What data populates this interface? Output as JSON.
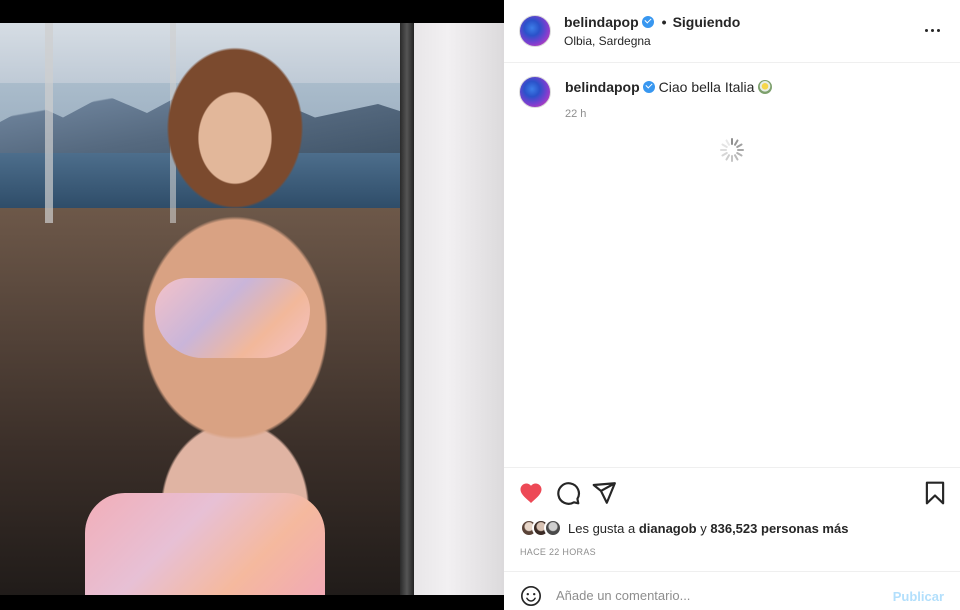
{
  "post": {
    "author": "belindapop",
    "dot": "•",
    "follow_status": "Siguiendo",
    "location": "Olbia, Sardegna",
    "caption_user": "belindapop",
    "caption_text": "Ciao bella Italia",
    "caption_emoji": "flower-emoji",
    "time_ago": "22 h"
  },
  "likes": {
    "prefix": "Les gusta a",
    "liked_by": "dianagob",
    "connector": "y",
    "count": "836,523",
    "suffix": "personas más"
  },
  "timestamp": "HACE 22 HORAS",
  "comment": {
    "placeholder": "Añade un comentario...",
    "publish_label": "Publicar"
  },
  "colors": {
    "like_red": "#ed4956",
    "verified_blue": "#3897f0",
    "publish_disabled": "#b2dffc"
  },
  "icons": [
    "verified-badge-icon",
    "more-options-icon",
    "heart-icon",
    "comment-icon",
    "share-icon",
    "bookmark-icon",
    "emoji-icon",
    "loading-spinner-icon"
  ]
}
